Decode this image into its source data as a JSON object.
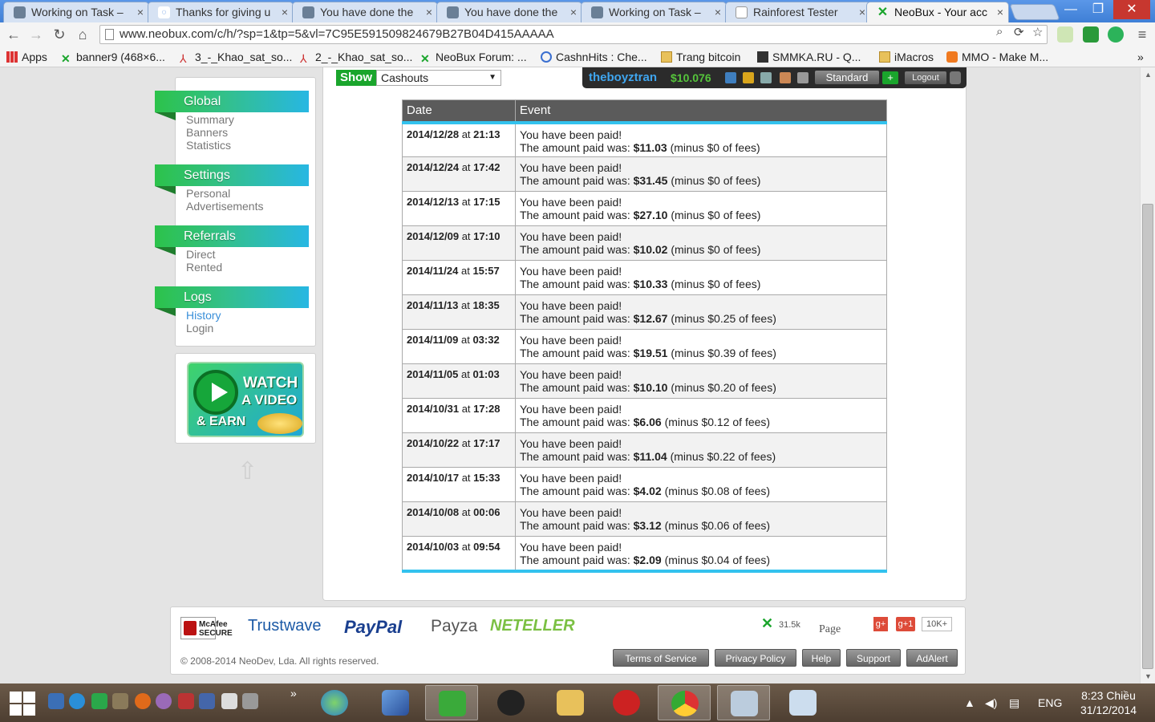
{
  "browser": {
    "tabs": [
      {
        "title": "Working on Task –",
        "active": false
      },
      {
        "title": "Thanks for giving u",
        "active": false
      },
      {
        "title": "You have done the",
        "active": false
      },
      {
        "title": "You have done the",
        "active": false
      },
      {
        "title": "Working on Task –",
        "active": false
      },
      {
        "title": "Rainforest Tester",
        "active": false
      },
      {
        "title": "NeoBux - Your acc",
        "active": true
      }
    ],
    "url": "www.neobux.com/c/h/?sp=1&tp=5&vl=7C95E591509824679B27B04D415AAAAA",
    "bookmarks": [
      {
        "label": "Apps"
      },
      {
        "label": "banner9 (468×6..."
      },
      {
        "label": "3_-_Khao_sat_so..."
      },
      {
        "label": "2_-_Khao_sat_so..."
      },
      {
        "label": "NeoBux Forum: ..."
      },
      {
        "label": "CashnHits : Che..."
      },
      {
        "label": "Trang bitcoin"
      },
      {
        "label": "SMMKA.RU - Q..."
      },
      {
        "label": "iMacros"
      },
      {
        "label": "MMO - Make M..."
      }
    ],
    "bookmarks_more": "»"
  },
  "userbar": {
    "username": "theboyztran",
    "balance": "$10.076",
    "membership": "Standard",
    "plus": "+",
    "logout": "Logout"
  },
  "filter": {
    "show_label": "Show",
    "selected": "Cashouts"
  },
  "sidebar": {
    "sections": [
      {
        "title": "Global",
        "items": [
          "Summary",
          "Banners",
          "Statistics"
        ]
      },
      {
        "title": "Settings",
        "items": [
          "Personal",
          "Advertisements"
        ]
      },
      {
        "title": "Referrals",
        "items": [
          "Direct",
          "Rented"
        ]
      },
      {
        "title": "Logs",
        "items": [
          "History",
          "Login"
        ]
      }
    ],
    "active_item": "History",
    "watch": {
      "line1": "WATCH",
      "line2": "A VIDEO",
      "line3": "& EARN"
    }
  },
  "history": {
    "columns": [
      "Date",
      "Event"
    ],
    "event_title": "You have been paid!",
    "amount_prefix": "The amount paid was: ",
    "rows": [
      {
        "date": "2014/12/28",
        "at": "at",
        "time": "21:13",
        "amount": "$11.03",
        "fees": "(minus $0 of fees)"
      },
      {
        "date": "2014/12/24",
        "at": "at",
        "time": "17:42",
        "amount": "$31.45",
        "fees": "(minus $0 of fees)"
      },
      {
        "date": "2014/12/13",
        "at": "at",
        "time": "17:15",
        "amount": "$27.10",
        "fees": "(minus $0 of fees)"
      },
      {
        "date": "2014/12/09",
        "at": "at",
        "time": "17:10",
        "amount": "$10.02",
        "fees": "(minus $0 of fees)"
      },
      {
        "date": "2014/11/24",
        "at": "at",
        "time": "15:57",
        "amount": "$10.33",
        "fees": "(minus $0 of fees)"
      },
      {
        "date": "2014/11/13",
        "at": "at",
        "time": "18:35",
        "amount": "$12.67",
        "fees": "(minus $0.25 of fees)"
      },
      {
        "date": "2014/11/09",
        "at": "at",
        "time": "03:32",
        "amount": "$19.51",
        "fees": "(minus $0.39 of fees)"
      },
      {
        "date": "2014/11/05",
        "at": "at",
        "time": "01:03",
        "amount": "$10.10",
        "fees": "(minus $0.20 of fees)"
      },
      {
        "date": "2014/10/31",
        "at": "at",
        "time": "17:28",
        "amount": "$6.06",
        "fees": "(minus $0.12 of fees)"
      },
      {
        "date": "2014/10/22",
        "at": "at",
        "time": "17:17",
        "amount": "$11.04",
        "fees": "(minus $0.22 of fees)"
      },
      {
        "date": "2014/10/17",
        "at": "at",
        "time": "15:33",
        "amount": "$4.02",
        "fees": "(minus $0.08 of fees)"
      },
      {
        "date": "2014/10/08",
        "at": "at",
        "time": "00:06",
        "amount": "$3.12",
        "fees": "(minus $0.06 of fees)"
      },
      {
        "date": "2014/10/03",
        "at": "at",
        "time": "09:54",
        "amount": "$2.09",
        "fees": "(minus $0.04 of fees)"
      }
    ]
  },
  "footer": {
    "logos": {
      "mcafee1": "McAfee",
      "mcafee2": "SECURE",
      "trustwave": "Trustwave",
      "paypal": "PayPal",
      "payza": "Payza",
      "neteller": "NETELLER"
    },
    "social": {
      "x_count": "31.5k",
      "page": "Page",
      "gplus": "g+",
      "gplus1": "g+1",
      "gcount": "10K+"
    },
    "copyright": "© 2008-2014 NeoDev, Lda. All rights reserved.",
    "links": [
      "Terms of Service",
      "Privacy Policy",
      "Help",
      "Support",
      "AdAlert"
    ]
  },
  "taskbar": {
    "lang": "ENG",
    "time": "8:23 Chiều",
    "date": "31/12/2014",
    "more": "»"
  },
  "colors": {
    "menu_green": "#2cc24a",
    "menu_blue": "#27b7e3",
    "table_header": "#5b5b5b",
    "accent_cyan": "#33c2ee",
    "show_green": "#1aa52c"
  }
}
